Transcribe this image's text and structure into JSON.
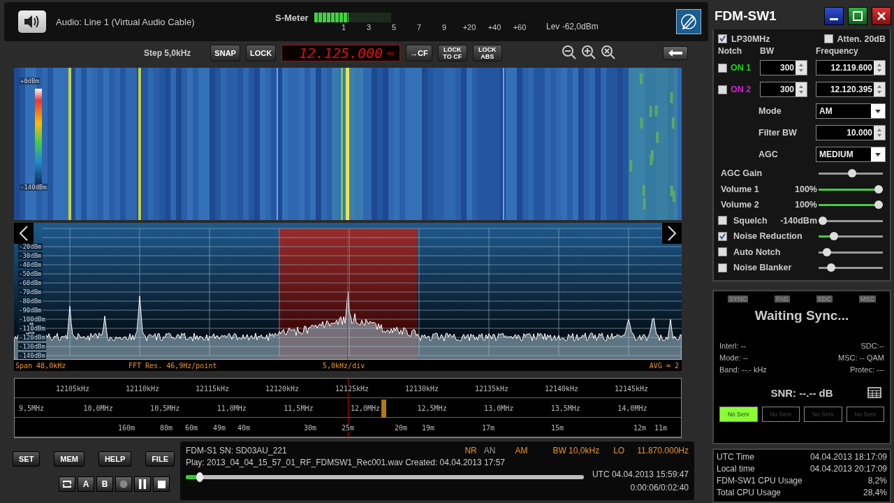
{
  "audio": "Audio: Line 1 (Virtual Audio Cable)",
  "s_meter": {
    "label": "S-Meter",
    "level": 0.45,
    "scale": [
      "1",
      "3",
      "5",
      "7",
      "9",
      "+20",
      "+40",
      "+60"
    ],
    "reading": "Lev -62,0dBm"
  },
  "toolbar": {
    "step": "Step 5,0kHz",
    "buttons": [
      "SNAP",
      "LOCK"
    ],
    "frequency": "12.125.000",
    "frequency_unit": "Hz",
    "lock_buttons": [
      "→CF",
      "LOCK TO CF",
      "LOCK ABS"
    ]
  },
  "waterfall": {
    "scale_top": "+0dBm",
    "scale_bottom": "-140dBm"
  },
  "spectrum": {
    "db_labels": [
      "-20dBm",
      "-30dBm",
      "-40dBm",
      "-50dBm",
      "-60dBm",
      "-70dBm",
      "-80dBm",
      "-90dBm",
      "-100dBm",
      "-110dBm",
      "-120dBm",
      "-130dBm",
      "-140dBm"
    ],
    "span": "Span 48,0kHz",
    "fft": "FFT Res. 46,9Hz/point",
    "div": "5,0kHz/div",
    "avg": "AVG = 2"
  },
  "scale": {
    "khz": [
      "12105kHz",
      "12110kHz",
      "12115kHz",
      "12120kHz",
      "12125kHz",
      "12130kHz",
      "12135kHz",
      "12140kHz",
      "12145kHz"
    ],
    "mhz": [
      "9,5MHz",
      "10,0MHz",
      "10,5MHz",
      "11,0MHz",
      "11,5MHz",
      "12,0MHz",
      "12,5MHz",
      "13,0MHz",
      "13,5MHz",
      "14,0MHz"
    ],
    "bands": [
      "160m",
      "80m",
      "60m",
      "49m",
      "40m",
      "30m",
      "25m",
      "20m",
      "19m",
      "17m",
      "15m",
      "12m",
      "11m"
    ]
  },
  "buttons": [
    "SET",
    "MEM",
    "HELP",
    "FILE"
  ],
  "transport": [
    {
      "kind": "loop"
    },
    {
      "kind": "letter",
      "label": "A"
    },
    {
      "kind": "letter",
      "label": "B"
    },
    {
      "kind": "record"
    },
    {
      "kind": "pause"
    },
    {
      "kind": "stop"
    }
  ],
  "status": {
    "device": "FDM-S1 SN: SD03AU_221",
    "flags": [
      {
        "label": "NR",
        "on": true
      },
      {
        "label": "AN",
        "on": false
      }
    ],
    "mode": "AM",
    "bw": "BW 10,0kHz",
    "lo_label": "LO",
    "lo": "11.870.000Hz",
    "play": "Play: 2013_04_04_15_57_01_RF_FDMSW1_Rec001.wav Created: 04.04.2013 17:57",
    "utc": "UTC 04.04.2013 15:59:47",
    "time": "0:00:06/0:02:40",
    "progress": {
      "level": 0.035
    }
  },
  "window": {
    "title": "FDM-SW1"
  },
  "filters": [
    {
      "label": "LP30MHz",
      "checked": true
    },
    {
      "label": "Atten. 20dB",
      "checked": false
    }
  ],
  "notch": {
    "headers": [
      "Notch",
      "BW",
      "Frequency"
    ],
    "rows": [
      {
        "label": "ON 1",
        "color": "#1fd41f",
        "checked": false,
        "bw": "300",
        "frequency": "12.119.600"
      },
      {
        "label": "ON 2",
        "color": "#d21fd2",
        "checked": false,
        "bw": "300",
        "frequency": "12.120.395"
      }
    ]
  },
  "settings": [
    {
      "kind": "dropdown",
      "label": "Mode",
      "value": "AM"
    },
    {
      "kind": "spin",
      "label": "Filter BW",
      "value": "10.000"
    },
    {
      "kind": "dropdown",
      "label": "AGC",
      "value": "MEDIUM"
    }
  ],
  "sliders": [
    {
      "kind": "plain",
      "label": "AGC Gain",
      "level": 0.53
    },
    {
      "kind": "volume",
      "label": "Volume 1",
      "reading": "100%",
      "level": 1
    },
    {
      "kind": "volume",
      "label": "Volume 2",
      "reading": "100%",
      "level": 1
    },
    {
      "kind": "check",
      "label": "Squelch",
      "reading": "-140dBm",
      "checked": false,
      "level": 0
    },
    {
      "kind": "check",
      "label": "Noise Reduction",
      "checked": true,
      "level": 0.2
    },
    {
      "kind": "check",
      "label": "Auto Notch",
      "checked": false,
      "level": 0.08
    },
    {
      "kind": "check",
      "label": "Noise Blanker",
      "checked": false,
      "level": 0.15
    }
  ],
  "drm": {
    "indicators": [
      {
        "label": "SYNC",
        "on": false
      },
      {
        "label": "FAC",
        "on": false
      },
      {
        "label": "SDC",
        "on": false
      },
      {
        "label": "MSC",
        "on": false
      }
    ],
    "status": "Waiting Sync...",
    "info": [
      {
        "left": "Interl: --",
        "right": "SDC:--"
      },
      {
        "left": "Mode: --",
        "right": "MSC: -- QAM"
      },
      {
        "left": "Band: --.- kHz",
        "right": "Protec: ---"
      }
    ],
    "snr": "SNR: --.-- dB",
    "services": [
      {
        "label": "No Serv",
        "selected": true
      },
      {
        "label": "No Serv",
        "selected": false
      },
      {
        "label": "No Serv",
        "selected": false
      },
      {
        "label": "No Serv",
        "selected": false
      }
    ]
  },
  "clock": [
    {
      "label": "UTC Time",
      "value": "04.04.2013 18:17:09"
    },
    {
      "label": "Local time",
      "value": "04.04.2013 20:17:09"
    },
    {
      "label": "FDM-SW1 CPU Usage",
      "value": "8,2%"
    },
    {
      "label": "Total CPU Usage",
      "value": "28,4%"
    }
  ]
}
